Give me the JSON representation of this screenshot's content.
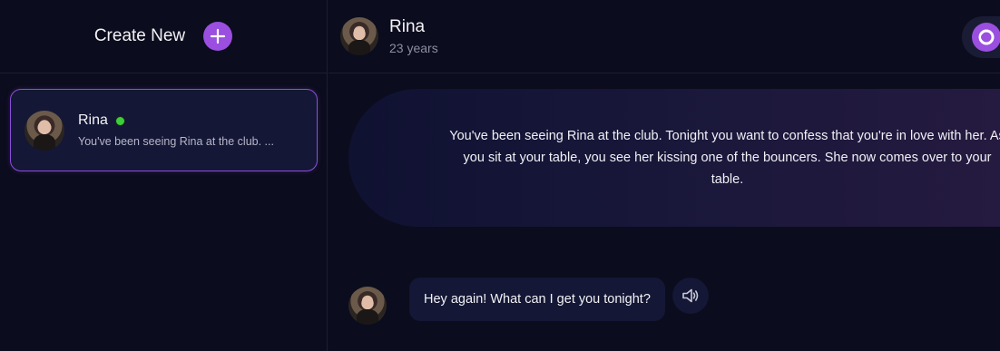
{
  "sidebar": {
    "create_label": "Create New",
    "chats": [
      {
        "name": "Rina",
        "status": "online",
        "preview": "You've been seeing Rina at the club. ..."
      }
    ]
  },
  "header": {
    "name": "Rina",
    "age": "23 years"
  },
  "scenario": {
    "text": "You've been seeing Rina at the club. Tonight you want to confess that you're in love with her. As you sit at your table, you see her kissing one of the bouncers. She now comes over to your table."
  },
  "messages": [
    {
      "sender": "Rina",
      "text": "Hey again! What can I get you tonight?"
    }
  ],
  "colors": {
    "accent": "#9a4fe0",
    "background": "#0b0c1d",
    "online": "#3bcf3b"
  },
  "icons": {
    "create": "plus-icon",
    "profile": "profile-ring-icon",
    "speaker": "speaker-icon"
  }
}
